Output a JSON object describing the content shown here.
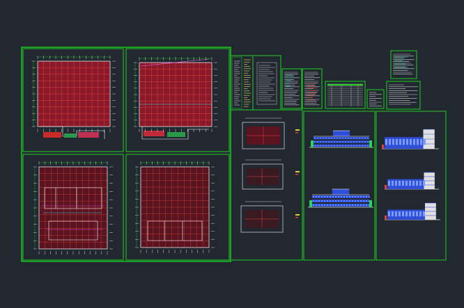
{
  "app": {
    "view": "model-space",
    "background": "#212830"
  },
  "colors": {
    "border": "#1fd01f",
    "border_dim": "#12a012",
    "plan_fill": "#8a1a2a",
    "grid": "#e04040",
    "wall": "#ffffff",
    "cyan": "#30d0e0",
    "yellow": "#e0d040",
    "magenta": "#e040e0",
    "blue": "#3050e0",
    "red": "#e02020"
  },
  "sheets": [
    {
      "id": "floor-plan-1",
      "kind": "grid-plan"
    },
    {
      "id": "floor-plan-2",
      "kind": "grid-plan"
    },
    {
      "id": "floor-plan-3",
      "kind": "detail-plan"
    },
    {
      "id": "floor-plan-4",
      "kind": "detail-plan"
    },
    {
      "id": "design-notes-1",
      "kind": "notes"
    },
    {
      "id": "design-notes-2",
      "kind": "notes"
    },
    {
      "id": "door-window-schedule",
      "kind": "table"
    },
    {
      "id": "detail-sheet-1",
      "kind": "details"
    },
    {
      "id": "detail-sheet-2",
      "kind": "details"
    },
    {
      "id": "material-table",
      "kind": "table"
    },
    {
      "id": "small-legend",
      "kind": "legend"
    },
    {
      "id": "site-key-plan",
      "kind": "key-plan"
    },
    {
      "id": "stair-details",
      "kind": "details"
    },
    {
      "id": "partial-plans",
      "kind": "plans"
    },
    {
      "id": "elevations-1",
      "kind": "elevations"
    },
    {
      "id": "elevations-2",
      "kind": "elevations"
    }
  ],
  "title_block_text": "",
  "icons": [
    "drawing-sheet-icon"
  ]
}
